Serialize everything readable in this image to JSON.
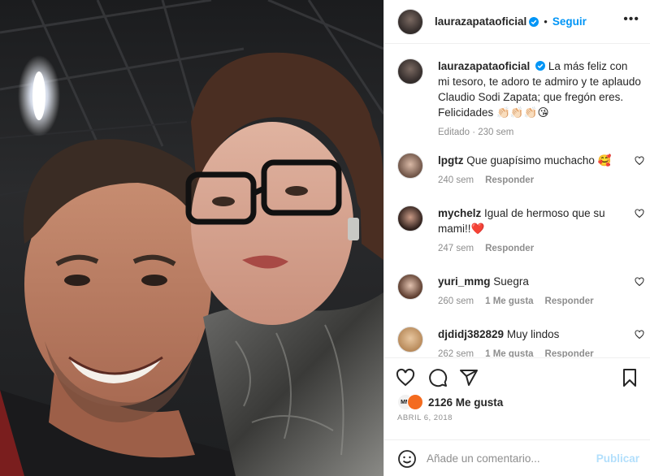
{
  "post": {
    "author": "laurazapataoficial",
    "follow_label": "Seguir",
    "separator": "•",
    "more_label": "•••",
    "caption_text": "La más feliz con mi tesoro, te adoro te admiro y te aplaudo Claudio Sodi Zapata; que fregón eres. Felicidades 👏🏻👏🏻👏🏻😘",
    "caption_meta": "Editado · 230 sem"
  },
  "comments": [
    {
      "user": "lpgtz",
      "text": "Que guapísimo muchacho 🥰",
      "age": "240 sem",
      "likes": "",
      "reply": "Responder"
    },
    {
      "user": "mychelz",
      "text": "Igual de hermoso que su mami!!❤️",
      "age": "247 sem",
      "likes": "",
      "reply": "Responder"
    },
    {
      "user": "yuri_mmg",
      "text": "Suegra",
      "age": "260 sem",
      "likes": "1 Me gusta",
      "reply": "Responder"
    },
    {
      "user": "djdidj382829",
      "text": "Muy lindos",
      "age": "262 sem",
      "likes": "1 Me gusta",
      "reply": "Responder"
    }
  ],
  "stats": {
    "likes_label": "2126 Me gusta",
    "date": "ABRIL 6, 2018"
  },
  "composer": {
    "placeholder": "Añade un comentario...",
    "publish_label": "Publicar"
  },
  "colors": {
    "accent": "#0095f6",
    "publish_disabled": "#b2dffc",
    "muted": "#8e8e8e",
    "heart": "#ed4956"
  },
  "icons": [
    "verified-badge-icon",
    "heart-icon",
    "comment-icon",
    "share-icon",
    "bookmark-icon",
    "emoji-icon",
    "more-icon"
  ]
}
